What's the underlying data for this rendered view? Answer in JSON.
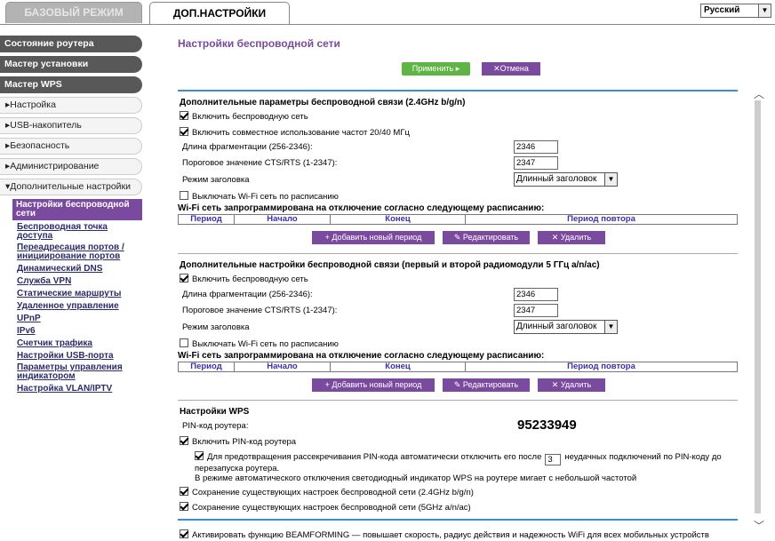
{
  "tabs": {
    "basic": "БАЗОВЫЙ РЕЖИМ",
    "advanced": "ДОП.НАСТРОЙКИ"
  },
  "language": {
    "selected": "Русский"
  },
  "sidebar": {
    "dark": [
      "Состояние роутера",
      "Мастер установки",
      "Мастер WPS"
    ],
    "light": [
      "▸Настройка",
      "▸USB-накопитель",
      "▸Безопасность",
      "▸Администрирование",
      "▾Дополнительные настройки"
    ],
    "subs": [
      "Настройки беспроводной сети",
      "Беспроводная точка доступа",
      "Переадресация портов / инициирование портов",
      "Динамический DNS",
      "Служба VPN",
      "Статические маршруты",
      "Удаленное управление",
      "UPnP",
      "IPv6",
      "Счетчик трафика",
      "Настройки USB-порта",
      "Параметры управления индикатором",
      "Настройка VLAN/IPTV"
    ]
  },
  "main": {
    "title": "Настройки беспроводной сети",
    "apply": "Применить ▸",
    "cancel": "✕Отмена",
    "sec1": {
      "title": "Дополнительные параметры беспроводной связи (2.4GHz b/g/n)",
      "enable_wifi": "Включить беспроводную сеть",
      "coexist": "Включить совместное использование частот 20/40 МГц",
      "frag_label": "Длина фрагментации (256-2346):",
      "frag_value": "2346",
      "cts_label": "Пороговое значение CTS/RTS (1-2347):",
      "cts_value": "2347",
      "preamble_label": "Режим заголовка",
      "preamble_value": "Длинный заголовок",
      "schedule": "Выключать Wi-Fi сеть по расписанию",
      "schedule_note": "Wi-Fi сеть запрограммирована на отключение согласно следующему расписанию:"
    },
    "sec2": {
      "title": "Дополнительные настройки беспроводной связи (первый и второй радиомодули 5 ГГц a/n/ac)",
      "enable_wifi": "Включить беспроводную сеть",
      "frag_label": "Длина фрагментации (256-2346):",
      "frag_value": "2346",
      "cts_label": "Пороговое значение CTS/RTS (1-2347):",
      "cts_value": "2347",
      "preamble_label": "Режим заголовка",
      "preamble_value": "Длинный заголовок",
      "schedule": "Выключать Wi-Fi сеть по расписанию",
      "schedule_note": "Wi-Fi сеть запрограммирована на отключение согласно следующему расписанию:"
    },
    "table_headers": [
      "Период",
      "Начало",
      "Конец",
      "Период повтора"
    ],
    "period_buttons": {
      "add": "+ Добавить новый период",
      "edit": "✎ Редактировать",
      "delete": "✕ Удалить"
    },
    "wps": {
      "title": "Настройки WPS",
      "pin_label": "PIN-код роутера:",
      "pin_value": "95233949",
      "enable_pin": "Включить PIN-код роутера",
      "protect_prefix": "Для предотвращения рассекречивания PIN-кода автоматически отключить его после",
      "protect_value": "3",
      "protect_suffix": "неудачных подключений по PIN-коду до",
      "protect_line2": "перезапуска роутера.",
      "protect_line3": "В режиме автоматического отключения светодиодный индикатор WPS на роутере мигает с небольшой частотой",
      "keep24": "Сохранение существующих настроек беспроводной сети (2.4GHz b/g/n)",
      "keep5": "Сохранение существующих настроек беспроводной сети (5GHz a/n/ac)"
    },
    "beamforming": "Активировать функцию BEAMFORMING — повышает скорость, радиус действия и надежность WiFi для всех мобильных устройств"
  }
}
